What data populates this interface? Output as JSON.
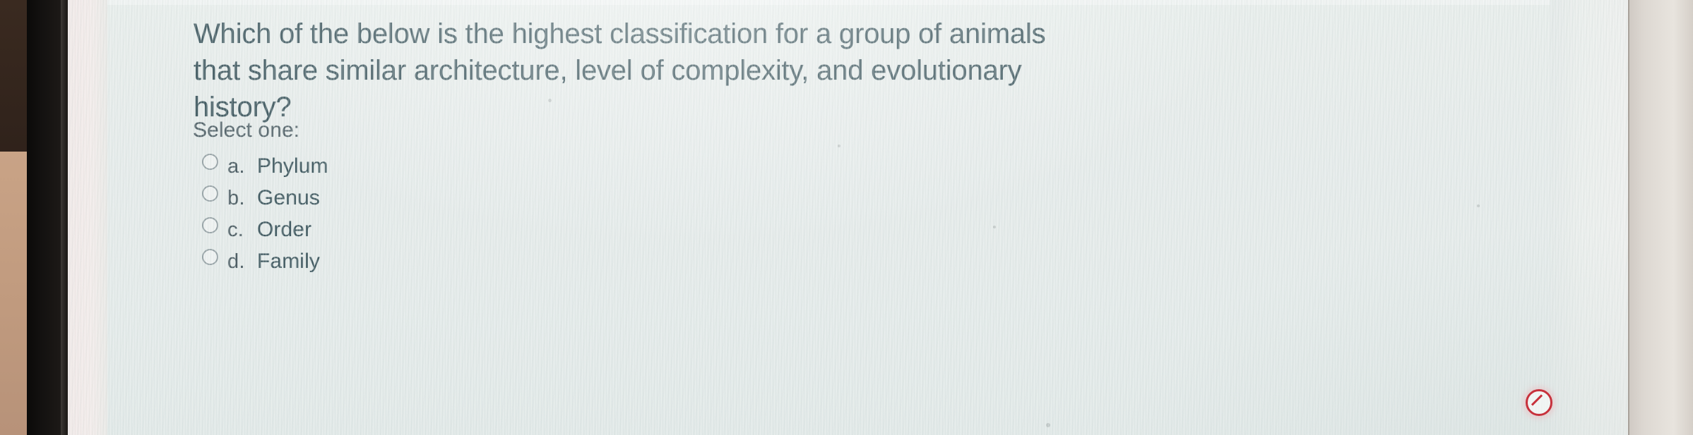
{
  "question": {
    "text": "Which of the below is the highest classification for a group of animals that share similar architecture, level of complexity, and evolutionary history?",
    "instruction": "Select one:"
  },
  "options": [
    {
      "letter": "a.",
      "label": "Phylum",
      "selected": false
    },
    {
      "letter": "b.",
      "label": "Genus",
      "selected": false
    },
    {
      "letter": "c.",
      "label": "Order",
      "selected": false
    },
    {
      "letter": "d.",
      "label": "Family",
      "selected": false
    }
  ],
  "cursor": {
    "icon": "no-entry-icon"
  },
  "colors": {
    "question_text": "#2f4a52",
    "label_text": "#44555c",
    "card_background": "#e4eae9",
    "page_gutter": "#efe7e6",
    "bezel": "#131110",
    "no_entry": "#c7313c"
  }
}
